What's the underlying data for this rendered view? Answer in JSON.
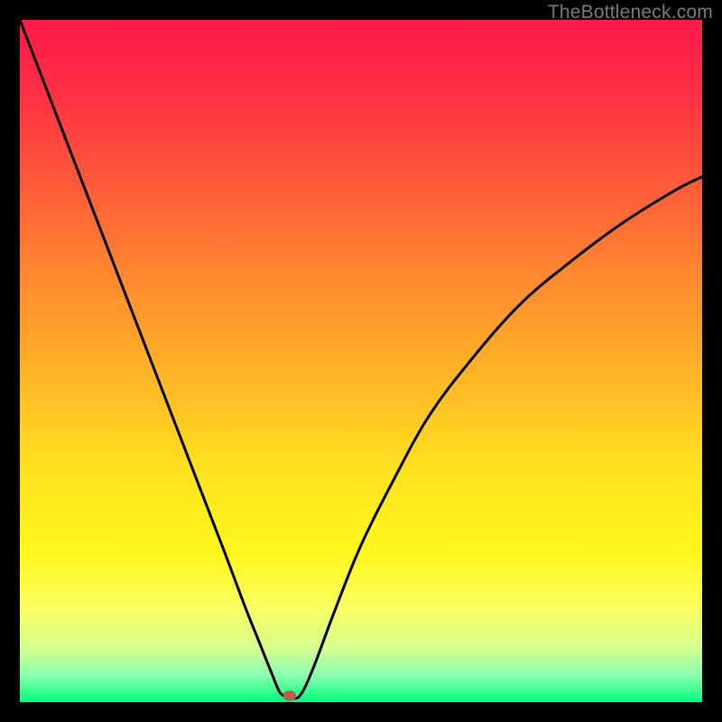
{
  "watermark": "TheBottleneck.com",
  "colors": {
    "frame": "#000000",
    "curve": "#000000",
    "vertex_dot": "#c15a4a",
    "gradient_top": "#ff1a4b",
    "gradient_bottom": "#00ff7a"
  },
  "chart_data": {
    "type": "line",
    "title": "",
    "xlabel": "",
    "ylabel": "",
    "xlim": [
      0,
      100
    ],
    "ylim": [
      0,
      100
    ],
    "grid": false,
    "note": "V-shaped bottleneck curve. y = 100 at plot top, y = 0 at plot bottom. Minimum (vertex) near x≈39, y≈0. Left branch nearly linear from top-left; right branch concave.",
    "series": [
      {
        "name": "left_branch",
        "x": [
          0,
          5,
          10,
          15,
          20,
          25,
          30,
          33,
          35,
          37,
          38.2
        ],
        "y": [
          100,
          87,
          74,
          61,
          48,
          35,
          22,
          14,
          9,
          4,
          1.3
        ]
      },
      {
        "name": "vertex_flat",
        "x": [
          38.2,
          39.5,
          41.0
        ],
        "y": [
          1.3,
          0.9,
          0.9
        ]
      },
      {
        "name": "right_branch",
        "x": [
          41.0,
          43,
          46,
          50,
          55,
          60,
          66,
          73,
          80,
          88,
          96,
          100
        ],
        "y": [
          0.9,
          5,
          13,
          23,
          33,
          42,
          50,
          58,
          64,
          70,
          75,
          77
        ]
      }
    ],
    "vertex": {
      "x": 39.5,
      "y": 0.9
    }
  }
}
